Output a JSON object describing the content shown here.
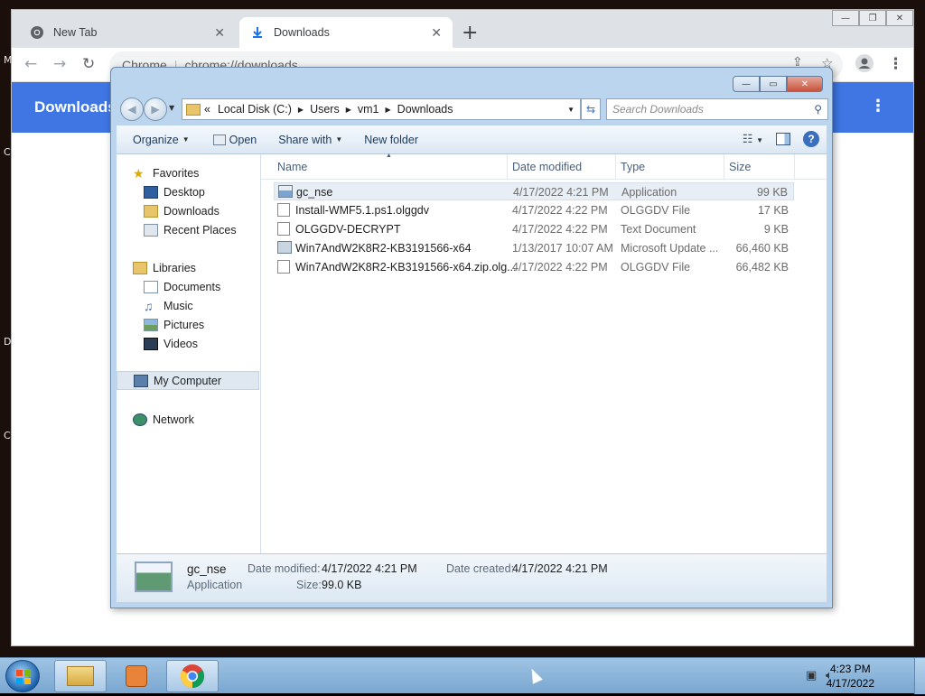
{
  "desktop": {
    "edge_letters": [
      "M",
      "C",
      "D",
      "C"
    ]
  },
  "chrome": {
    "tabs": [
      {
        "title": "New Tab",
        "icon": "chrome-icon"
      },
      {
        "title": "Downloads",
        "icon": "download-icon"
      }
    ],
    "tab_close": "✕",
    "new_tab": "+",
    "window_controls": {
      "minimize": "—",
      "restore": "❐",
      "close": "✕"
    },
    "omnibox": {
      "site": "Chrome",
      "url": "chrome://downloads"
    },
    "page_title": "Downloads",
    "menu": "⋮"
  },
  "explorer": {
    "title_controls": {
      "minimize": "—",
      "maximize": "▭",
      "close": "✕"
    },
    "breadcrumb": {
      "prefix": "«",
      "parts": [
        "Local Disk (C:)",
        "Users",
        "vm1",
        "Downloads"
      ]
    },
    "search_placeholder": "Search Downloads",
    "commands": {
      "organize": "Organize",
      "open": "Open",
      "share_with": "Share with",
      "new_folder": "New folder"
    },
    "nav": {
      "favorites": "Favorites",
      "desktop": "Desktop",
      "downloads": "Downloads",
      "recent_places": "Recent Places",
      "libraries": "Libraries",
      "documents": "Documents",
      "music": "Music",
      "pictures": "Pictures",
      "videos": "Videos",
      "my_computer": "My Computer",
      "network": "Network"
    },
    "columns": {
      "name": "Name",
      "date_modified": "Date modified",
      "type": "Type",
      "size": "Size"
    },
    "files": [
      {
        "name": "gc_nse",
        "date": "4/17/2022 4:21 PM",
        "type": "Application",
        "size": "99 KB",
        "icon": "application-icon"
      },
      {
        "name": "Install-WMF5.1.ps1.olggdv",
        "date": "4/17/2022 4:22 PM",
        "type": "OLGGDV File",
        "size": "17 KB",
        "icon": "file-icon"
      },
      {
        "name": "OLGGDV-DECRYPT",
        "date": "4/17/2022 4:22 PM",
        "type": "Text Document",
        "size": "9 KB",
        "icon": "text-file-icon"
      },
      {
        "name": "Win7AndW2K8R2-KB3191566-x64",
        "date": "1/13/2017 10:07 AM",
        "type": "Microsoft Update ...",
        "size": "66,460 KB",
        "icon": "update-icon"
      },
      {
        "name": "Win7AndW2K8R2-KB3191566-x64.zip.olg...",
        "date": "4/17/2022 4:22 PM",
        "type": "OLGGDV File",
        "size": "66,482 KB",
        "icon": "file-icon"
      }
    ],
    "details": {
      "name": "gc_nse",
      "type": "Application",
      "date_modified_label": "Date modified:",
      "date_modified": "4/17/2022 4:21 PM",
      "size_label": "Size:",
      "size": "99.0 KB",
      "date_created_label": "Date created:",
      "date_created": "4/17/2022 4:21 PM"
    }
  },
  "taskbar": {
    "apps": [
      "explorer-icon",
      "media-player-icon",
      "chrome-icon"
    ],
    "time": "4:23 PM",
    "date": "4/17/2022"
  }
}
